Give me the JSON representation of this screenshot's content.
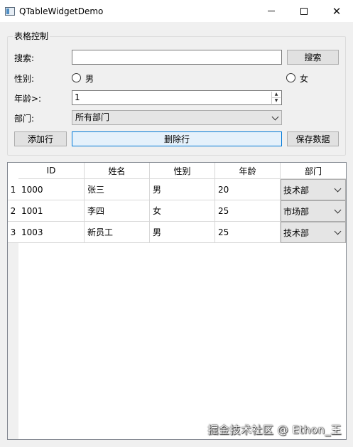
{
  "window": {
    "title": "QTableWidgetDemo",
    "controls": {
      "minimize": "minimize-icon",
      "maximize": "maximize-icon",
      "close": "✕"
    }
  },
  "group": {
    "title": "表格控制",
    "search": {
      "label": "搜索:",
      "value": "",
      "button": "搜索"
    },
    "gender": {
      "label": "性别:",
      "options": [
        "男",
        "女"
      ],
      "selected": null
    },
    "age": {
      "label": "年龄>:",
      "value": "1"
    },
    "dept": {
      "label": "部门:",
      "selected": "所有部门"
    },
    "actions": {
      "add": "添加行",
      "delete": "删除行",
      "save": "保存数据"
    }
  },
  "table": {
    "columns": [
      "ID",
      "姓名",
      "性别",
      "年龄",
      "部门"
    ],
    "row_headers": [
      "1",
      "2",
      "3"
    ],
    "rows": [
      {
        "id": "1000",
        "name": "张三",
        "gender": "男",
        "age": "20",
        "dept": "技术部"
      },
      {
        "id": "1001",
        "name": "李四",
        "gender": "女",
        "age": "25",
        "dept": "市场部"
      },
      {
        "id": "1003",
        "name": "新员工",
        "gender": "男",
        "age": "25",
        "dept": "技术部"
      }
    ]
  },
  "watermark": "掘金技术社区 @ Ethon_王",
  "colors": {
    "focus_border": "#0078d7",
    "focus_bg": "#e5f1fb",
    "window_bg": "#f0f0f0"
  }
}
